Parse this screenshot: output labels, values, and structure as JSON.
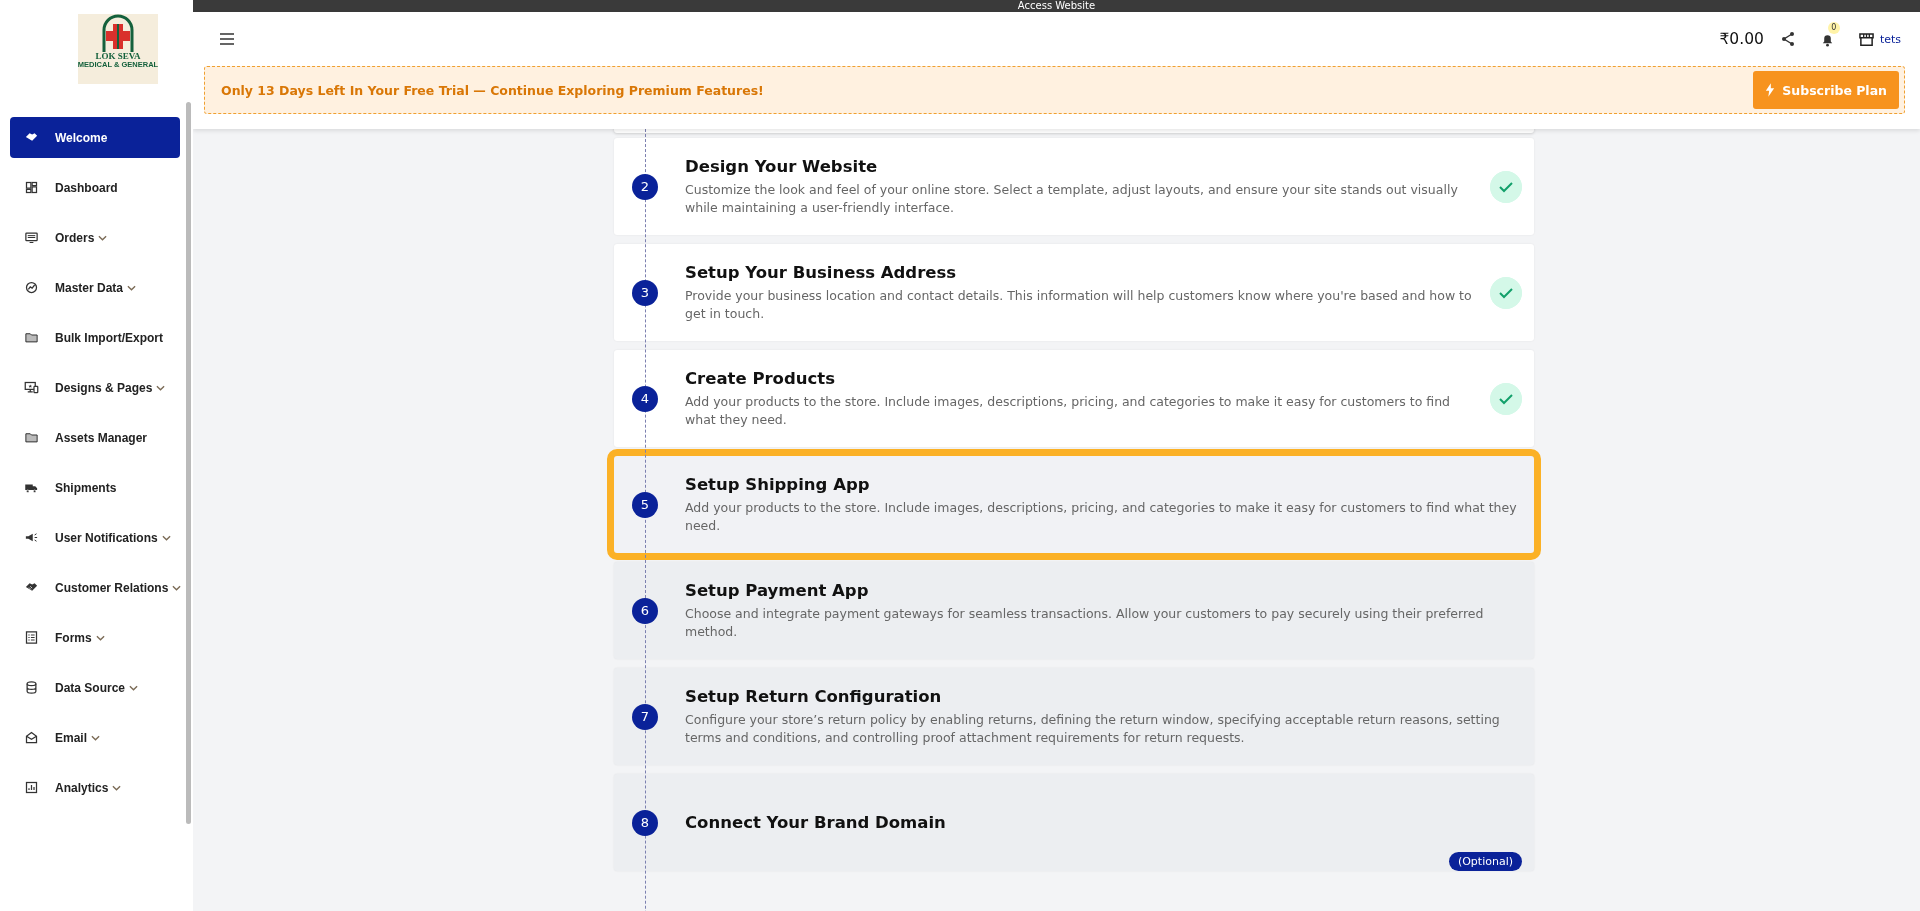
{
  "top_bar": {
    "title": "Access Website"
  },
  "logo": {
    "title": "LOK SEVA",
    "subtitle": "MEDICAL & GENERAL"
  },
  "sidebar": {
    "items": [
      {
        "label": "Welcome",
        "selected": true,
        "expandable": false
      },
      {
        "label": "Dashboard",
        "selected": false,
        "expandable": false
      },
      {
        "label": "Orders",
        "selected": false,
        "expandable": true
      },
      {
        "label": "Master Data",
        "selected": false,
        "expandable": true
      },
      {
        "label": "Bulk Import/Export",
        "selected": false,
        "expandable": false
      },
      {
        "label": "Designs & Pages",
        "selected": false,
        "expandable": true
      },
      {
        "label": "Assets Manager",
        "selected": false,
        "expandable": false
      },
      {
        "label": "Shipments",
        "selected": false,
        "expandable": false
      },
      {
        "label": "User Notifications",
        "selected": false,
        "expandable": true
      },
      {
        "label": "Customer Relations",
        "selected": false,
        "expandable": true
      },
      {
        "label": "Forms",
        "selected": false,
        "expandable": true
      },
      {
        "label": "Data Source",
        "selected": false,
        "expandable": true
      },
      {
        "label": "Email",
        "selected": false,
        "expandable": true
      },
      {
        "label": "Analytics",
        "selected": false,
        "expandable": true
      }
    ]
  },
  "header": {
    "balance": "₹0.00",
    "notification_count": "0",
    "store_label": "tets"
  },
  "banner": {
    "message": "Only 13 Days Left In Your Free Trial — Continue Exploring Premium Features!",
    "button": "Subscribe Plan"
  },
  "steps": [
    {
      "number": "2",
      "title": "Design Your Website",
      "description": "Customize the look and feel of your online store. Select a template, adjust layouts, and ensure your site stands out visually while maintaining a user-friendly interface.",
      "completed": true,
      "highlighted": false
    },
    {
      "number": "3",
      "title": "Setup Your Business Address",
      "description": "Provide your business location and contact details. This information will help customers know where you're based and how to get in touch.",
      "completed": true,
      "highlighted": false
    },
    {
      "number": "4",
      "title": "Create Products",
      "description": "Add your products to the store. Include images, descriptions, pricing, and categories to make it easy for customers to find what they need.",
      "completed": true,
      "highlighted": false
    },
    {
      "number": "5",
      "title": "Setup Shipping App",
      "description": "Add your products to the store. Include images, descriptions, pricing, and categories to make it easy for customers to find what they need.",
      "completed": false,
      "highlighted": true
    },
    {
      "number": "6",
      "title": "Setup Payment App",
      "description": "Choose and integrate payment gateways for seamless transactions. Allow your customers to pay securely using their preferred method.",
      "completed": false,
      "highlighted": false
    },
    {
      "number": "7",
      "title": "Setup Return Configuration",
      "description": "Configure your store’s return policy by enabling returns, defining the return window, specifying acceptable return reasons, setting terms and conditions, and controlling proof attachment requirements for return requests.",
      "completed": false,
      "highlighted": false
    },
    {
      "number": "8",
      "title": "Connect Your Brand Domain",
      "badge": "(Optional)",
      "completed": false,
      "highlighted": false
    }
  ]
}
